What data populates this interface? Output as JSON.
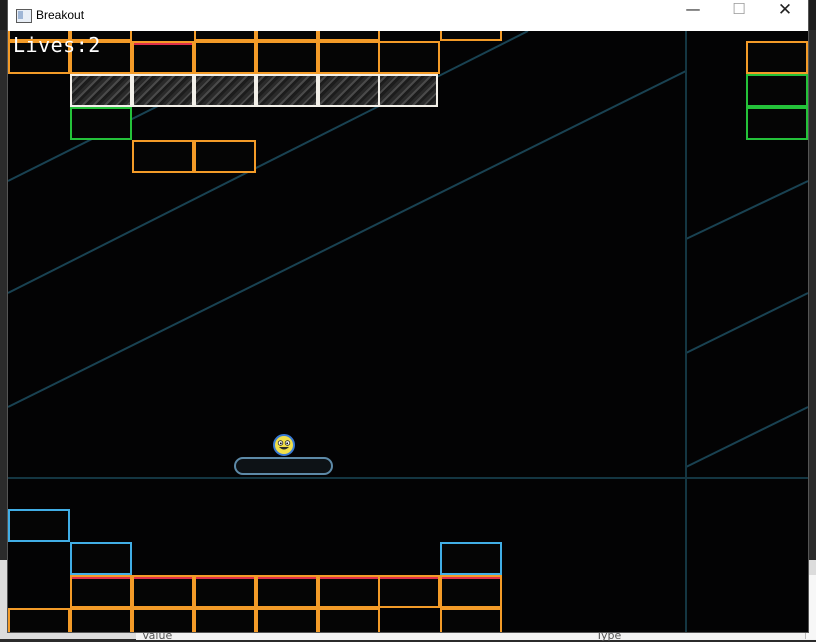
{
  "window": {
    "title": "Breakout",
    "controls": {
      "minimize": "—",
      "maximize": "☐",
      "close": "✕"
    }
  },
  "hud": {
    "lives": "Lives:2"
  },
  "background_panel": {
    "col_value": "Value",
    "col_type": "Type"
  },
  "colors": {
    "orange_brick": "#f39b28",
    "green_brick": "#24c23a",
    "cyan_brick": "#41aee6",
    "solid_brick_border": "#f2efe8",
    "paddle": "#5d8aa8",
    "ball": "#f2e04a"
  },
  "icons": {
    "app": "window-app-icon",
    "ball": "smiley-face-icon"
  }
}
